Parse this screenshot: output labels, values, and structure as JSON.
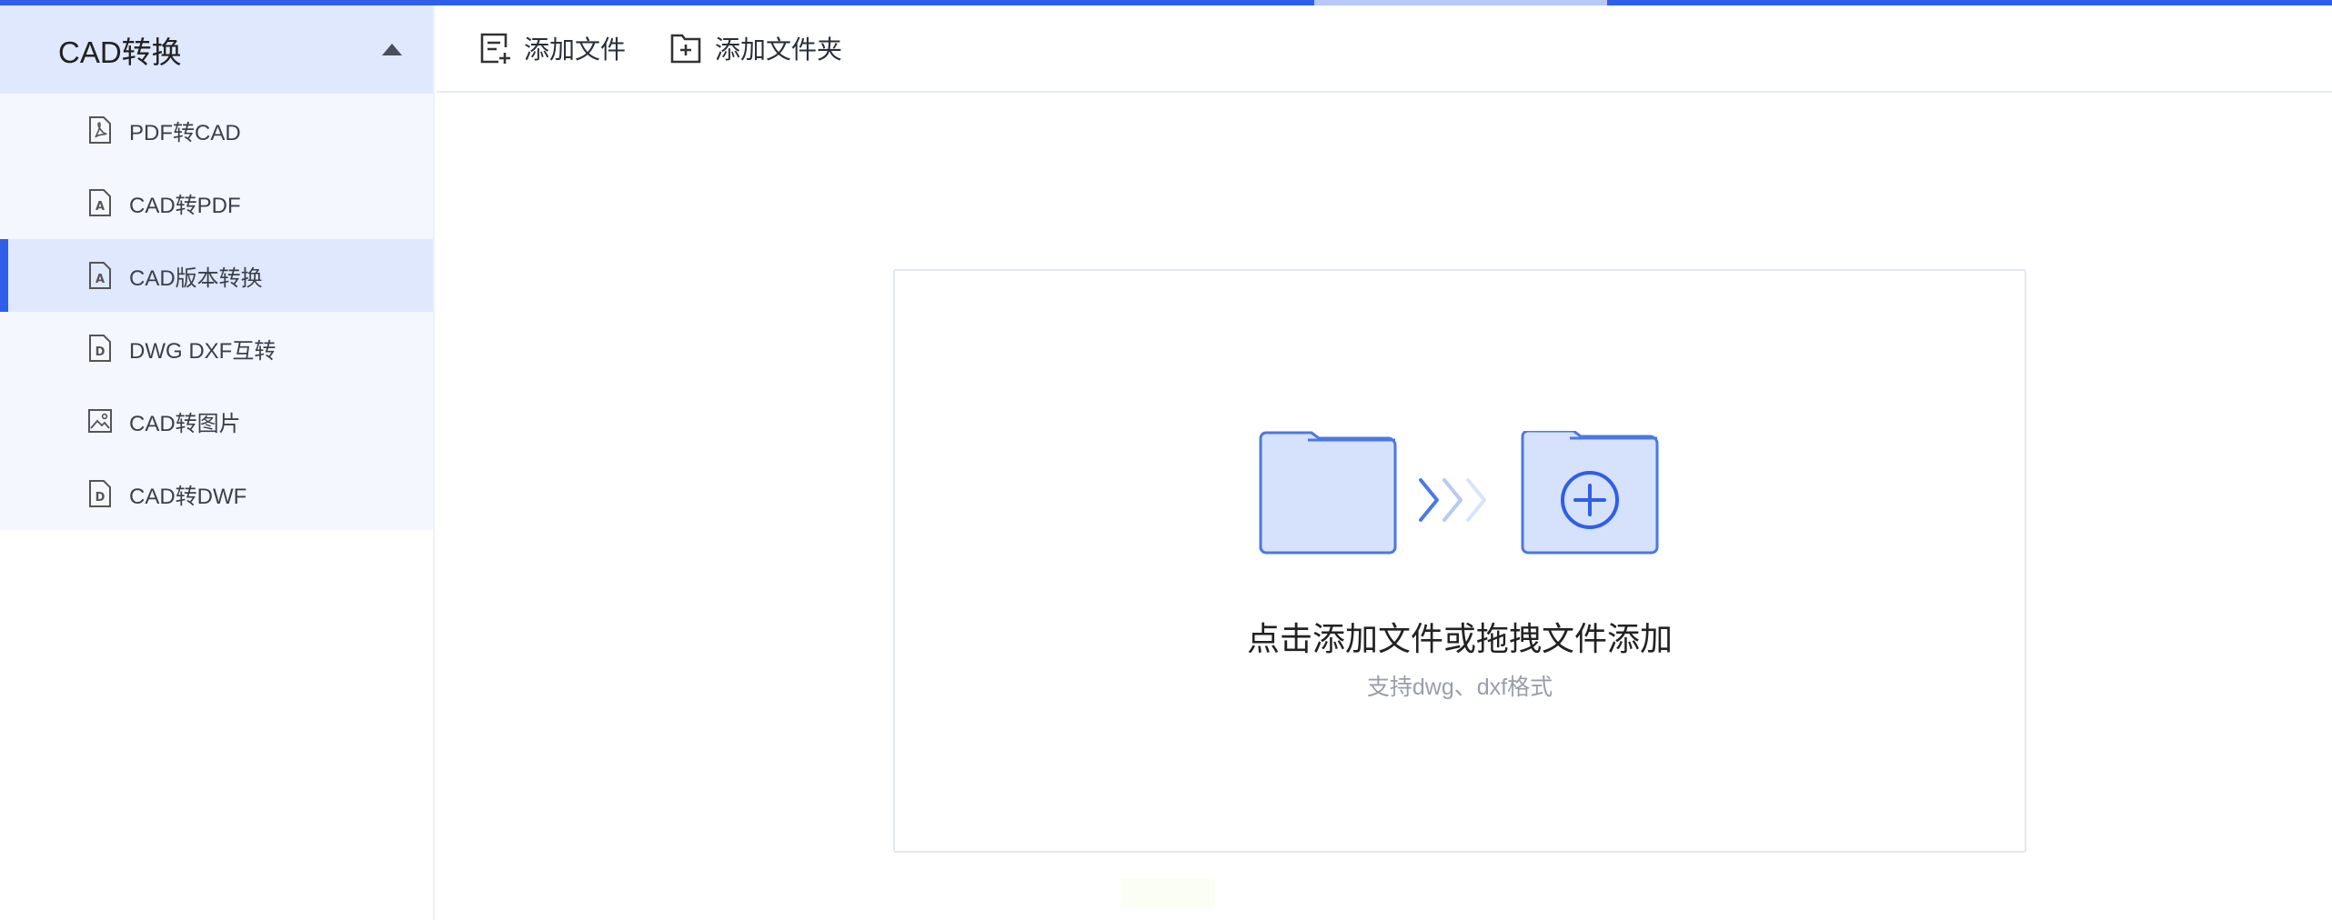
{
  "sidebar": {
    "group_title": "CAD转换",
    "items": [
      {
        "label": "PDF转CAD",
        "icon": "pdf-file-icon",
        "active": false
      },
      {
        "label": "CAD转PDF",
        "icon": "a-file-icon",
        "active": false
      },
      {
        "label": "CAD版本转换",
        "icon": "a-file-icon",
        "active": true
      },
      {
        "label": "DWG DXF互转",
        "icon": "d-file-icon",
        "active": false
      },
      {
        "label": "CAD转图片",
        "icon": "image-icon",
        "active": false
      },
      {
        "label": "CAD转DWF",
        "icon": "d-file-icon",
        "active": false
      }
    ]
  },
  "toolbar": {
    "add_file_label": "添加文件",
    "add_folder_label": "添加文件夹"
  },
  "dropzone": {
    "title": "点击添加文件或拖拽文件添加",
    "subtitle": "支持dwg、dxf格式"
  },
  "colors": {
    "accent": "#2f5ee8",
    "active_bg": "#dfe8fd",
    "menu_bg": "#f4f7fe",
    "illustration_fill": "#d6e2fb",
    "illustration_stroke": "#4a78e6"
  }
}
